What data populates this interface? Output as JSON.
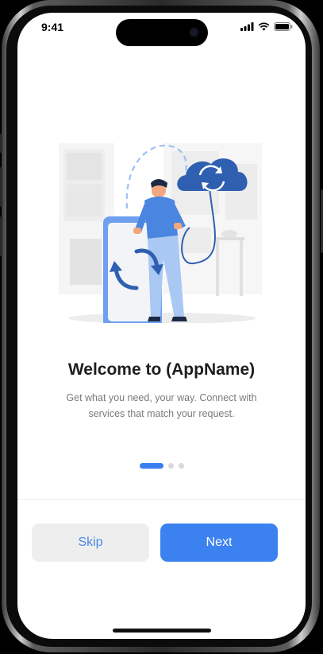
{
  "status": {
    "time": "9:41"
  },
  "onboarding": {
    "title": "Welcome to (AppName)",
    "subtitle": "Get what you need, your way. Connect with services that match your request.",
    "page_count": 3,
    "current_page": 1
  },
  "buttons": {
    "skip_label": "Skip",
    "next_label": "Next"
  },
  "colors": {
    "accent": "#3b82f0",
    "skip_text": "#4a86e8",
    "cloud": "#2f5fb0"
  },
  "icons": [
    "signal-icon",
    "wifi-icon",
    "battery-icon",
    "sync-icon",
    "cloud-sync-icon"
  ]
}
